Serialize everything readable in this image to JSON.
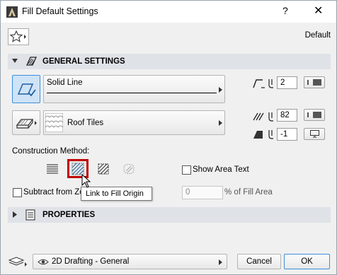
{
  "window": {
    "title": "Fill Default Settings",
    "help": "?",
    "close": "✕"
  },
  "header": {
    "default_label": "Default"
  },
  "general": {
    "title": "GENERAL SETTINGS",
    "line_type": "Solid Line",
    "fill_type": "Roof Tiles",
    "pen_line": "2",
    "pen_fg": "82",
    "pen_bg": "-1"
  },
  "construction": {
    "label": "Construction Method:",
    "show_area_text": "Show Area Text",
    "subtract_label": "Subtract from Zo",
    "percent_value": "0",
    "percent_label": "% of Fill Area",
    "tooltip": "Link to Fill Origin"
  },
  "properties": {
    "title": "PROPERTIES"
  },
  "footer": {
    "layer": "2D Drafting - General",
    "cancel": "Cancel",
    "ok": "OK"
  },
  "colors": {
    "accent": "#3c8fdc",
    "highlight": "#c00000",
    "section_bg": "#dfe3e8"
  }
}
